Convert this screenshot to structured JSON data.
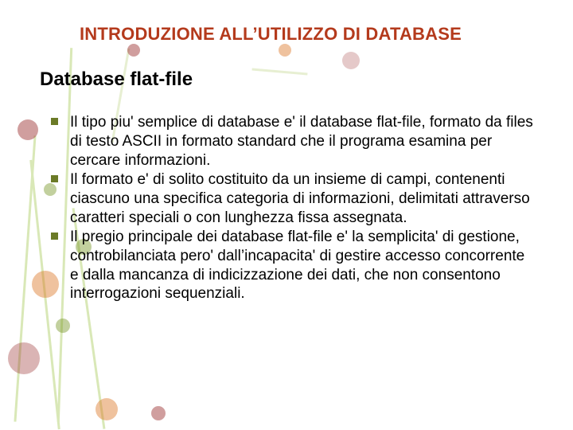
{
  "title": "INTRODUZIONE ALL’UTILIZZO DI DATABASE",
  "subtitle": "Database flat-file",
  "bullets": [
    "Il tipo piu' semplice di database e' il database flat-file, formato da files di testo ASCII in formato standard che il programa esamina per cercare informazioni.",
    "Il formato e' di solito costituito da un insieme di campi, contenenti ciascuno una specifica categoria di informazioni, delimitati attraverso caratteri speciali o con lunghezza fissa assegnata.",
    "Il pregio principale dei database flat-file e' la semplicita' di gestione, controbilanciata pero' dall’incapacita' di gestire accesso concorrente e dalla mancanza di indicizzazione dei dati, che non consentono interrogazioni sequenziali."
  ],
  "colors": {
    "title": "#b43a1c",
    "bullet_marker": "#6b7a27"
  }
}
